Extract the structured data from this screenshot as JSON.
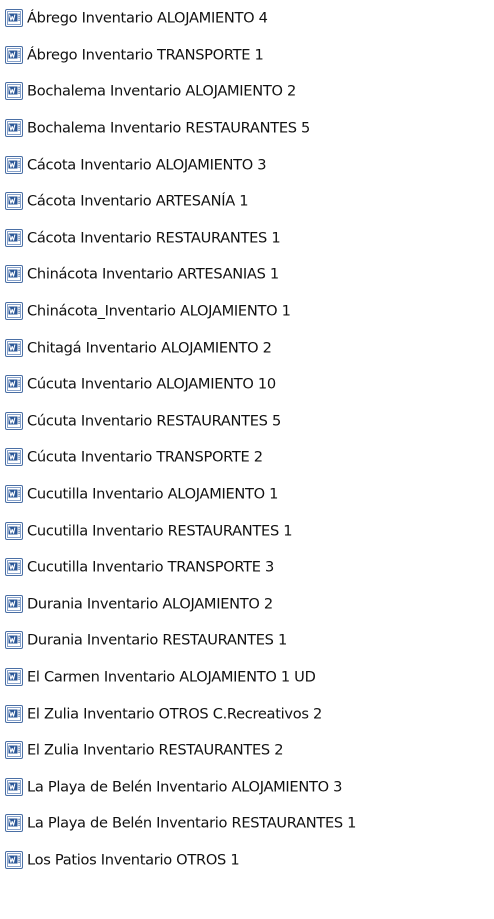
{
  "files": [
    {
      "name": "Ábrego Inventario ALOJAMIENTO 4",
      "icon": "word-document-icon"
    },
    {
      "name": "Ábrego Inventario TRANSPORTE 1",
      "icon": "word-document-icon"
    },
    {
      "name": "Bochalema Inventario ALOJAMIENTO 2",
      "icon": "word-document-icon"
    },
    {
      "name": "Bochalema Inventario RESTAURANTES 5",
      "icon": "word-document-icon"
    },
    {
      "name": "Cácota Inventario ALOJAMIENTO 3",
      "icon": "word-document-icon"
    },
    {
      "name": "Cácota Inventario ARTESANÍA 1",
      "icon": "word-document-icon"
    },
    {
      "name": "Cácota Inventario RESTAURANTES 1",
      "icon": "word-document-icon"
    },
    {
      "name": "Chinácota Inventario ARTESANIAS 1",
      "icon": "word-document-icon"
    },
    {
      "name": "Chinácota_Inventario ALOJAMIENTO 1",
      "icon": "word-document-icon"
    },
    {
      "name": "Chitagá Inventario ALOJAMIENTO 2",
      "icon": "word-document-icon"
    },
    {
      "name": "Cúcuta Inventario ALOJAMIENTO 10",
      "icon": "word-document-icon"
    },
    {
      "name": "Cúcuta Inventario RESTAURANTES 5",
      "icon": "word-document-icon"
    },
    {
      "name": "Cúcuta Inventario TRANSPORTE 2",
      "icon": "word-document-icon"
    },
    {
      "name": "Cucutilla Inventario ALOJAMIENTO 1",
      "icon": "word-document-icon"
    },
    {
      "name": "Cucutilla Inventario RESTAURANTES 1",
      "icon": "word-document-icon"
    },
    {
      "name": "Cucutilla Inventario TRANSPORTE 3",
      "icon": "word-document-icon"
    },
    {
      "name": "Durania Inventario ALOJAMIENTO 2",
      "icon": "word-document-icon"
    },
    {
      "name": "Durania Inventario RESTAURANTES 1",
      "icon": "word-document-icon"
    },
    {
      "name": "El Carmen Inventario ALOJAMIENTO 1 UD",
      "icon": "word-document-icon"
    },
    {
      "name": "El Zulia Inventario OTROS C.Recreativos 2",
      "icon": "word-document-icon"
    },
    {
      "name": "El Zulia Inventario RESTAURANTES 2",
      "icon": "word-document-icon"
    },
    {
      "name": "La Playa de Belén Inventario ALOJAMIENTO 3",
      "icon": "word-document-icon"
    },
    {
      "name": "La Playa de Belén Inventario RESTAURANTES 1",
      "icon": "word-document-icon"
    },
    {
      "name": "Los Patios Inventario OTROS 1",
      "icon": "word-document-icon"
    }
  ],
  "colors": {
    "text": "#111111",
    "background": "#ffffff",
    "icon_blue": "#2b5797",
    "icon_page": "#f4f4f4"
  }
}
